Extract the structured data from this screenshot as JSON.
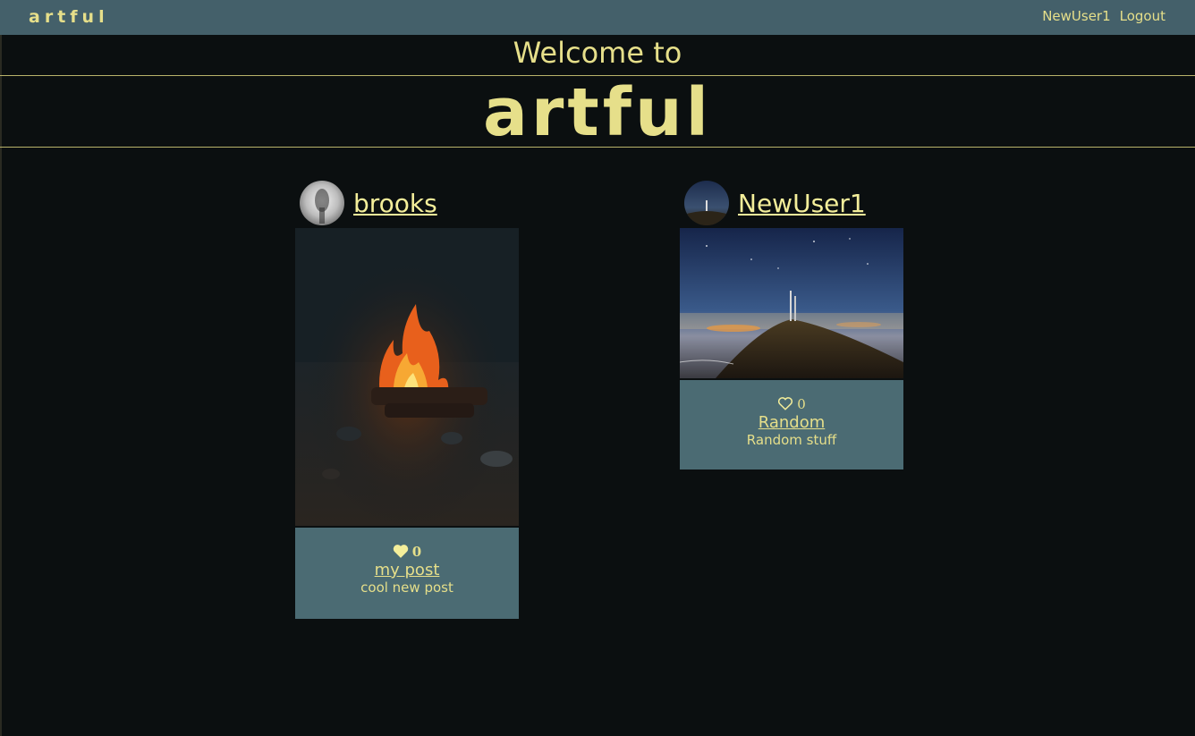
{
  "navbar": {
    "brand": "artful",
    "user_link": "NewUser1",
    "logout_label": "Logout"
  },
  "hero": {
    "welcome": "Welcome to",
    "title": "artful"
  },
  "posts": [
    {
      "username": "brooks",
      "likes": "0",
      "liked": true,
      "title": "my post",
      "description": "cool new post",
      "image": "campfire at night"
    },
    {
      "username": "NewUser1",
      "likes": "0",
      "liked": false,
      "title": "Random",
      "description": "Random stuff",
      "image": "mountain antenna under starry sky"
    }
  ],
  "colors": {
    "accent": "#e6df8a",
    "navbar": "#44606a",
    "card": "#4b6b73",
    "background": "#0b0f10"
  }
}
